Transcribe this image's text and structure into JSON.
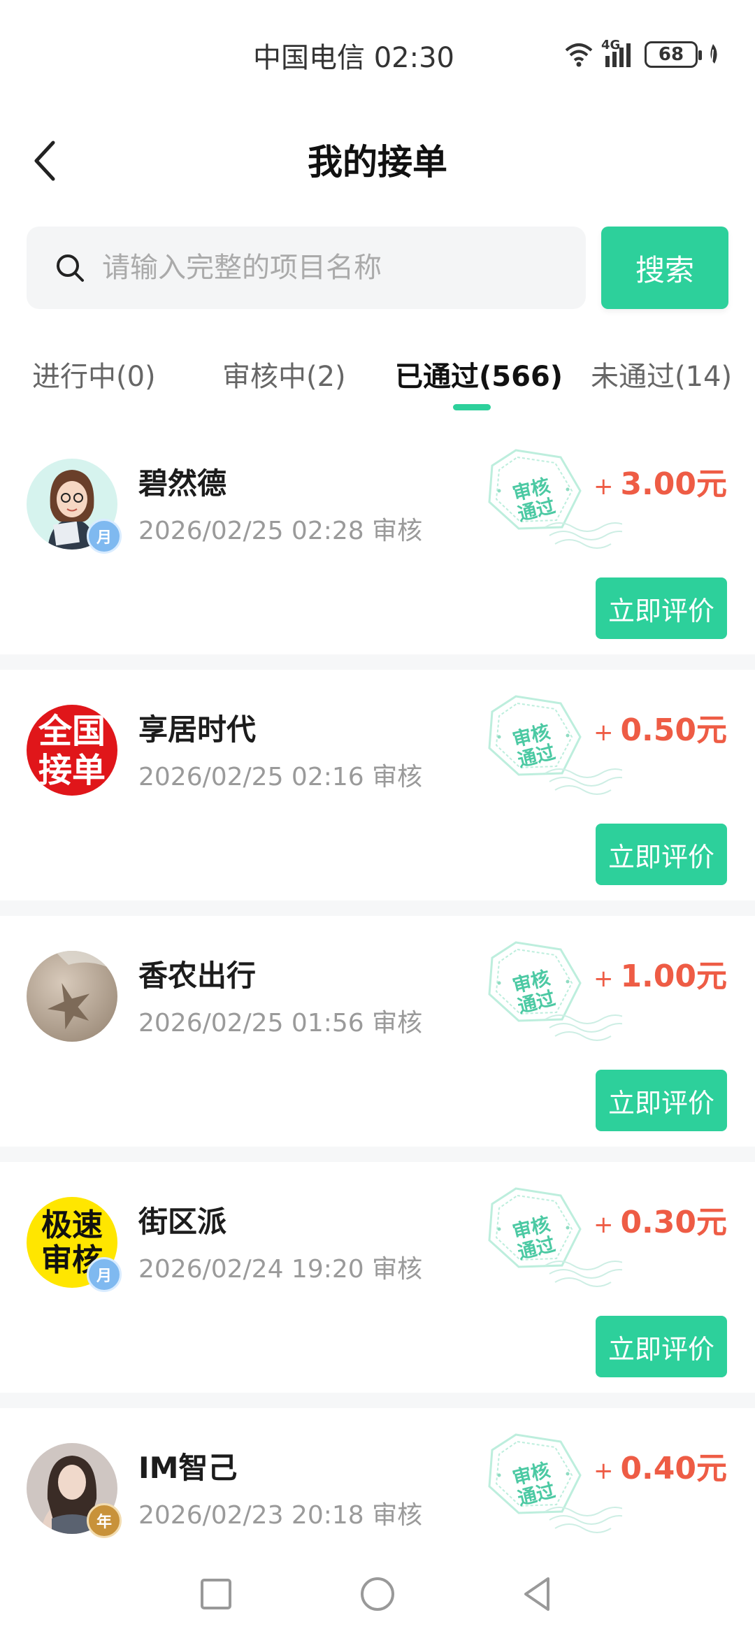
{
  "status_bar": {
    "carrier_time": "中国电信 02:30",
    "network": "4G",
    "battery": "68",
    "icons": [
      "wifi-icon",
      "signal-icon",
      "battery-icon",
      "leaf-icon"
    ]
  },
  "header": {
    "title": "我的接单",
    "back_icon": "chevron-left-icon"
  },
  "search": {
    "placeholder": "请输入完整的项目名称",
    "value": "",
    "button_label": "搜索",
    "icon": "search-icon"
  },
  "tabs": [
    {
      "label": "进行中(0)",
      "active": false
    },
    {
      "label": "审核中(2)",
      "active": false
    },
    {
      "label": "已通过(566)",
      "active": true
    },
    {
      "label": "未通过(14)",
      "active": false
    }
  ],
  "colors": {
    "accent": "#2dd09b",
    "amount": "#ee5c45",
    "stamp": "#4cc9a3"
  },
  "orders": [
    {
      "name": "碧然德",
      "time": "2026/02/25 02:28 审核",
      "stamp": "审核通过",
      "plus": "+",
      "amount": "3.00元",
      "action": "立即评价",
      "avatar": "cartoon-girl-avatar",
      "badge": "月"
    },
    {
      "name": "享居时代",
      "time": "2026/02/25 02:16 审核",
      "stamp": "审核通过",
      "plus": "+",
      "amount": "0.50元",
      "action": "立即评价",
      "avatar_text": "全国接单",
      "badge": ""
    },
    {
      "name": "香农出行",
      "time": "2026/02/25 01:56 审核",
      "stamp": "审核通过",
      "plus": "+",
      "amount": "1.00元",
      "action": "立即评价",
      "avatar": "starfish-sand-avatar",
      "badge": ""
    },
    {
      "name": "街区派",
      "time": "2026/02/24 19:20 审核",
      "stamp": "审核通过",
      "plus": "+",
      "amount": "0.30元",
      "action": "立即评价",
      "avatar_text": "极速审核",
      "badge": "月"
    },
    {
      "name": "IM智己",
      "time": "2026/02/23 20:18 审核",
      "stamp": "审核通过",
      "plus": "+",
      "amount": "0.40元",
      "action": "立即评价",
      "avatar": "photo-girl-avatar",
      "badge": "年"
    }
  ],
  "nav_bar": [
    "recent-apps-icon",
    "home-icon",
    "back-icon"
  ]
}
